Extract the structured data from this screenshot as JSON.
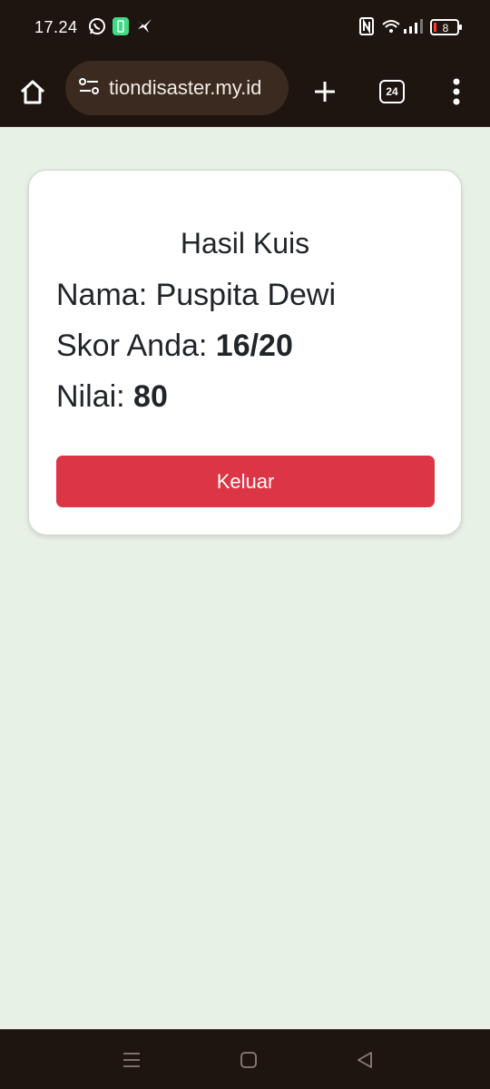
{
  "status_bar": {
    "time": "17.24",
    "battery_level": "8",
    "icons": [
      "whatsapp-icon",
      "app-notification-icon",
      "bird-icon",
      "nfc-icon",
      "wifi-icon",
      "signal-icon",
      "battery-icon"
    ]
  },
  "browser": {
    "url": "tiondisaster.my.id",
    "tab_count": "24",
    "icons": [
      "home-icon",
      "site-settings-icon",
      "new-tab-icon",
      "tab-switcher-icon",
      "more-menu-icon"
    ]
  },
  "result": {
    "title": "Hasil Kuis",
    "name_label": "Nama: ",
    "name_value": "Puspita Dewi",
    "score_label": "Skor Anda: ",
    "score_value": "16/20",
    "grade_label": "Nilai: ",
    "grade_value": "80",
    "exit_button": "Keluar"
  },
  "colors": {
    "page_background": "#e8f1e6",
    "system_bar": "#1e1410",
    "exit_button": "#dc3545"
  },
  "navigation": {
    "icons": [
      "recents-icon",
      "home-nav-icon",
      "back-icon"
    ]
  }
}
